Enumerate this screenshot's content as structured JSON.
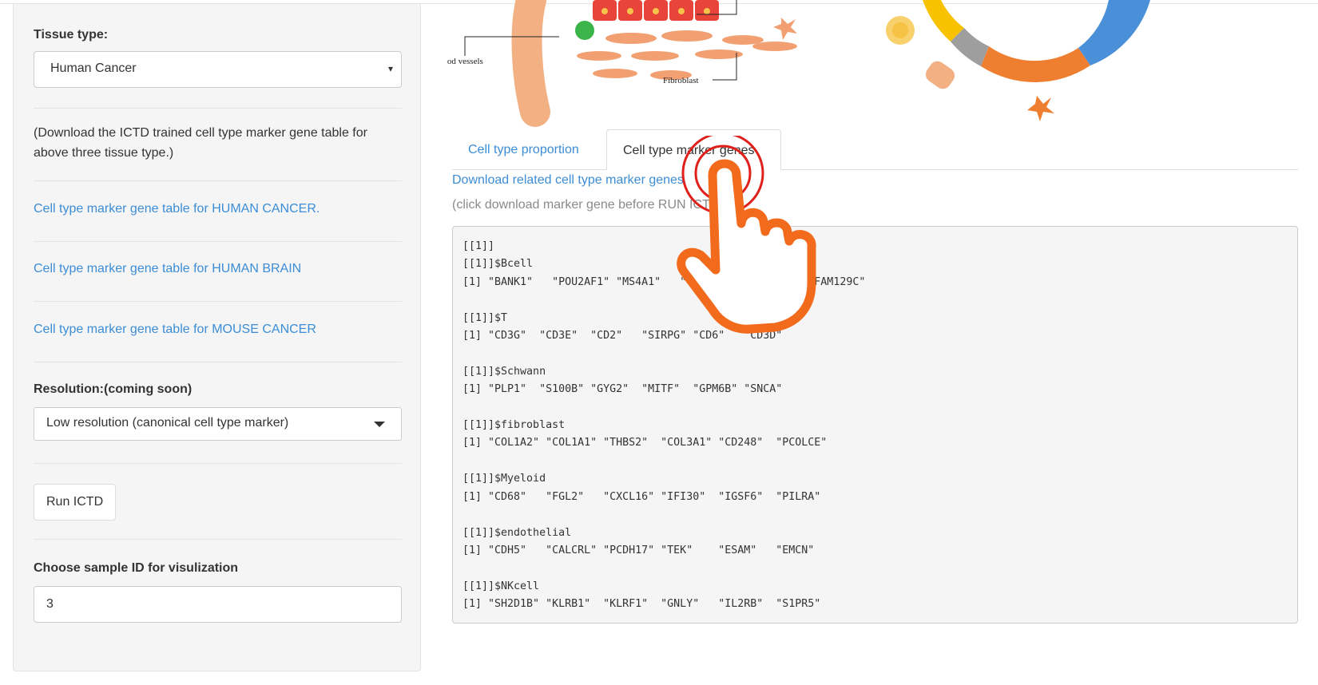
{
  "sidebar": {
    "tissue_label": "Tissue type:",
    "tissue_value": "Human Cancer",
    "download_note": "(Download the ICTD trained cell type marker gene table for above three tissue type.)",
    "links": [
      "Cell type marker gene table for HUMAN CANCER.",
      "Cell type marker gene table for HUMAN BRAIN",
      "Cell type marker gene table for MOUSE CANCER"
    ],
    "resolution_label": "Resolution:(coming soon)",
    "resolution_value": "Low resolution (canonical cell type marker)",
    "run_button": "Run ICTD",
    "sample_label": "Choose sample ID for visulization",
    "sample_value": "3"
  },
  "illustration": {
    "blood_vessels_label": "Blood vessels",
    "fibroblast_label": "Fibroblast"
  },
  "main": {
    "tabs": [
      {
        "label": "Cell type proportion",
        "active": false
      },
      {
        "label": "Cell type marker genes",
        "active": true
      }
    ],
    "download_link": "Download related cell type marker genes",
    "hint": "(click download marker gene before RUN ICTD)",
    "output_lines": [
      "[[1]]",
      "[[1]]$Bcell",
      "[1] \"BANK1\"   \"POU2AF1\" \"MS4A1\"   \"CD79A\"   \"CD79B\"   \"FAM129C\"",
      "",
      "[[1]]$T",
      "[1] \"CD3G\"  \"CD3E\"  \"CD2\"   \"SIRPG\" \"CD6\"   \"CD3D\"",
      "",
      "[[1]]$Schwann",
      "[1] \"PLP1\"  \"S100B\" \"GYG2\"  \"MITF\"  \"GPM6B\" \"SNCA\"",
      "",
      "[[1]]$fibroblast",
      "[1] \"COL1A2\" \"COL1A1\" \"THBS2\"  \"COL3A1\" \"CD248\"  \"PCOLCE\"",
      "",
      "[[1]]$Myeloid",
      "[1] \"CD68\"   \"FGL2\"   \"CXCL16\" \"IFI30\"  \"IGSF6\"  \"PILRA\"",
      "",
      "[[1]]$endothelial",
      "[1] \"CDH5\"   \"CALCRL\" \"PCDH17\" \"TEK\"    \"ESAM\"   \"EMCN\"",
      "",
      "[[1]]$NKcell",
      "[1] \"SH2D1B\" \"KLRB1\"  \"KLRF1\"  \"GNLY\"   \"IL2RB\"  \"S1PR5\""
    ]
  },
  "colors": {
    "link": "#3c8dd6",
    "pointer_orange": "#f26b1d",
    "click_ring": "#e0201b"
  },
  "icons": {
    "pointer": "pointing-hand-icon",
    "dropdown": "caret-down-icon"
  }
}
